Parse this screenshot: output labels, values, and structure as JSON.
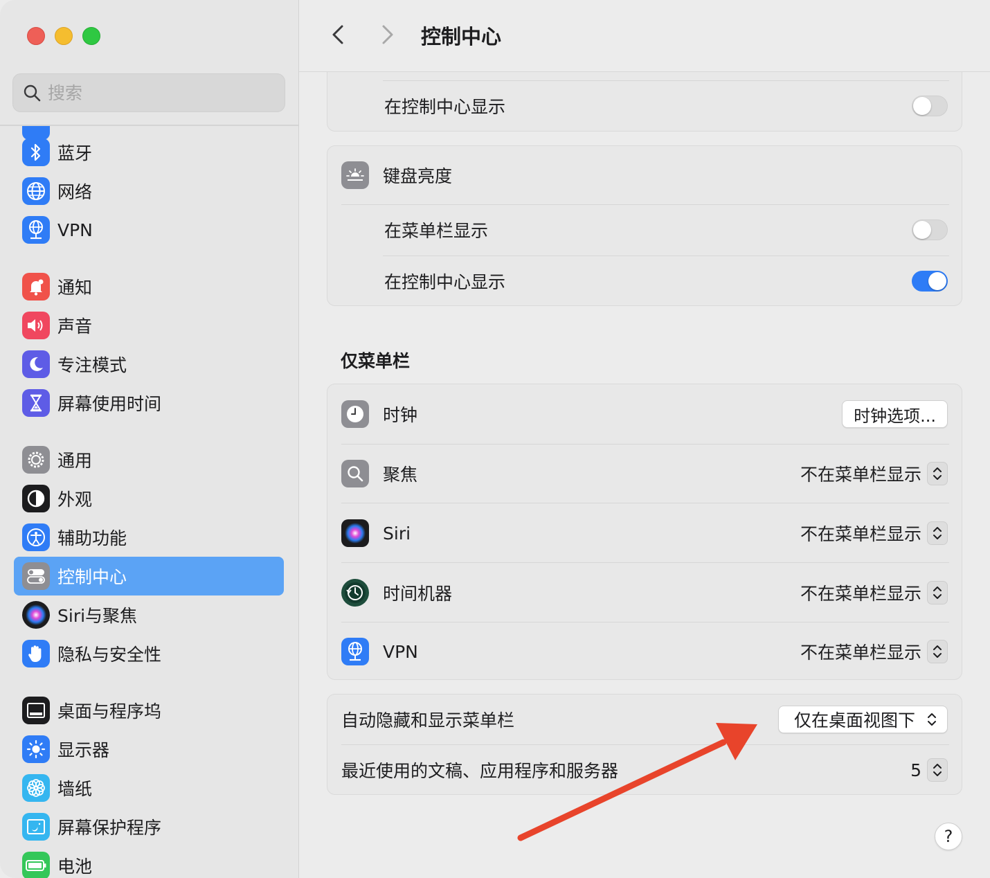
{
  "window": {
    "title": "控制中心"
  },
  "sidebar": {
    "search_placeholder": "搜索",
    "items": [
      {
        "id": "bluetooth",
        "label": "蓝牙",
        "icon": "bluetooth-icon",
        "color": "#2f7cf6"
      },
      {
        "id": "network",
        "label": "网络",
        "icon": "globe-icon",
        "color": "#2f7cf6"
      },
      {
        "id": "vpn",
        "label": "VPN",
        "icon": "vpn-globe-icon",
        "color": "#2f7cf6"
      },
      {
        "id": "notifications",
        "label": "通知",
        "icon": "bell-icon",
        "color": "#f0524a"
      },
      {
        "id": "sound",
        "label": "声音",
        "icon": "speaker-icon",
        "color": "#f0475f"
      },
      {
        "id": "focus",
        "label": "专注模式",
        "icon": "moon-icon",
        "color": "#5e5ce6"
      },
      {
        "id": "screentime",
        "label": "屏幕使用时间",
        "icon": "hourglass-icon",
        "color": "#5e5ce6"
      },
      {
        "id": "general",
        "label": "通用",
        "icon": "gear-icon",
        "color": "#8e8e93"
      },
      {
        "id": "appearance",
        "label": "外观",
        "icon": "appearance-icon",
        "color": "#1c1c1e"
      },
      {
        "id": "accessibility",
        "label": "辅助功能",
        "icon": "accessibility-icon",
        "color": "#2f7cf6"
      },
      {
        "id": "controlcenter",
        "label": "控制中心",
        "icon": "switches-icon",
        "color": "#8e8e93",
        "active": true
      },
      {
        "id": "siri",
        "label": "Siri与聚焦",
        "icon": "siri-icon",
        "color": "#1c1c1e"
      },
      {
        "id": "privacy",
        "label": "隐私与安全性",
        "icon": "hand-icon",
        "color": "#2f7cf6"
      },
      {
        "id": "desktop",
        "label": "桌面与程序坞",
        "icon": "dock-icon",
        "color": "#1c1c1e"
      },
      {
        "id": "displays",
        "label": "显示器",
        "icon": "sun-icon",
        "color": "#2f7cf6"
      },
      {
        "id": "wallpaper",
        "label": "墙纸",
        "icon": "flower-icon",
        "color": "#35b6f0"
      },
      {
        "id": "screensaver",
        "label": "屏幕保护程序",
        "icon": "screensaver-icon",
        "color": "#35b6f0"
      },
      {
        "id": "battery",
        "label": "电池",
        "icon": "battery-icon",
        "color": "#34c759"
      }
    ]
  },
  "main": {
    "top_card": {
      "show_in_cc_label": "在控制中心显示",
      "show_in_cc_on": false
    },
    "keyboard_card": {
      "title": "键盘亮度",
      "show_in_menubar_label": "在菜单栏显示",
      "show_in_menubar_on": false,
      "show_in_cc_label": "在控制中心显示",
      "show_in_cc_on": true
    },
    "menubar_only": {
      "section_title": "仅菜单栏",
      "clock": {
        "label": "时钟",
        "button": "时钟选项..."
      },
      "rows": [
        {
          "label": "聚焦",
          "value": "不在菜单栏显示",
          "icon": "magnifier-icon"
        },
        {
          "label": "Siri",
          "value": "不在菜单栏显示",
          "icon": "siri-icon"
        },
        {
          "label": "时间机器",
          "value": "不在菜单栏显示",
          "icon": "time-machine-icon"
        },
        {
          "label": "VPN",
          "value": "不在菜单栏显示",
          "icon": "vpn-globe-icon"
        }
      ]
    },
    "bottom_card": {
      "autohide_label": "自动隐藏和显示菜单栏",
      "autohide_value": "仅在桌面视图下",
      "recent_label": "最近使用的文稿、应用程序和服务器",
      "recent_value": "5"
    },
    "help_label": "?"
  },
  "annotation": {
    "arrow_color": "#e8442b"
  }
}
